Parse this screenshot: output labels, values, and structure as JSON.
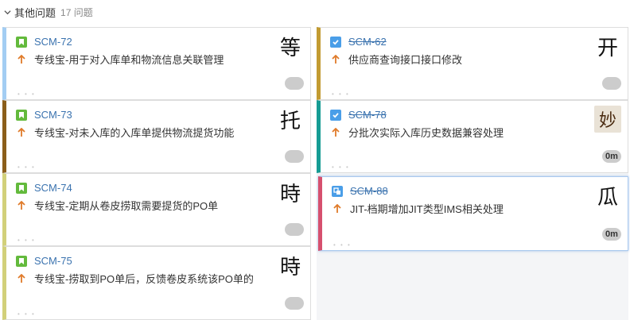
{
  "swimlane": {
    "chevron_icon": "chevron-down-icon",
    "title": "其他问题",
    "count": "17 问题"
  },
  "colors": {
    "link": "#3b73af",
    "story": "#63ba3c",
    "task_done": "#4a9ee8",
    "subtask": "#4a9ee8",
    "priority_high": "#e07b2a"
  },
  "columns": {
    "left": {
      "cards": [
        {
          "key": "SCM-72",
          "summary": "专线宝-用于对入库单和物流信息关联管理",
          "type_icon": "story-icon",
          "priority_icon": "priority-high-icon",
          "avatar": "等",
          "estimate": "",
          "stripe": "#a3cdf3",
          "done": false
        },
        {
          "key": "SCM-73",
          "summary": "专线宝-对未入库的入库单提供物流提货功能",
          "type_icon": "story-icon",
          "priority_icon": "priority-high-icon",
          "avatar": "托",
          "estimate": "",
          "stripe": "#8b5e1a",
          "done": false
        },
        {
          "key": "SCM-74",
          "summary": "专线宝-定期从卷皮捞取需要提货的PO单",
          "type_icon": "story-icon",
          "priority_icon": "priority-high-icon",
          "avatar": "時",
          "estimate": "",
          "stripe": "#d2d07a",
          "done": false
        },
        {
          "key": "SCM-75",
          "summary": "专线宝-捞取到PO单后，反馈卷皮系统该PO单的",
          "type_icon": "story-icon",
          "priority_icon": "priority-high-icon",
          "avatar": "時",
          "estimate": "",
          "stripe": "#d2d07a",
          "done": false
        }
      ]
    },
    "right": {
      "cards": [
        {
          "key": "SCM-62",
          "summary": "供应商查询接口接口修改",
          "type_icon": "task-done-icon",
          "priority_icon": "priority-high-icon",
          "avatar": "开",
          "estimate": "",
          "stripe": "#c29b32",
          "done": true
        },
        {
          "key": "SCM-78",
          "summary": "分批次实际入库历史数据兼容处理",
          "type_icon": "task-done-icon",
          "priority_icon": "priority-high-icon",
          "avatar": "妙",
          "estimate": "0m",
          "stripe": "#169c94",
          "done": true
        },
        {
          "key": "SCM-88",
          "summary": "JIT-档期增加JIT类型IMS相关处理",
          "type_icon": "subtask-icon",
          "priority_icon": "priority-high-icon",
          "avatar": "瓜",
          "estimate": "0m",
          "stripe": "#d6506e",
          "done": true
        }
      ]
    }
  }
}
